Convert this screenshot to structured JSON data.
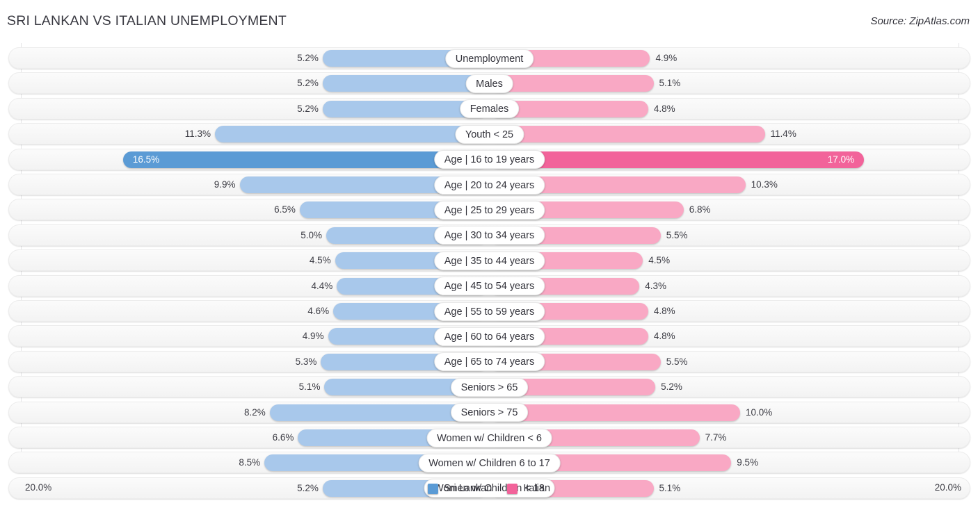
{
  "header": {
    "title": "SRI LANKAN VS ITALIAN UNEMPLOYMENT",
    "source": "Source: ZipAtlas.com"
  },
  "axis": {
    "left_label": "20.0%",
    "right_label": "20.0%",
    "max": 20.0
  },
  "legend": {
    "items": [
      {
        "label": "Sri Lankan",
        "color": "#5b9bd5"
      },
      {
        "label": "Italian",
        "color": "#f2639a"
      }
    ]
  },
  "colors": {
    "blue_light": "#a8c8eb",
    "blue_dark": "#5b9bd5",
    "pink_light": "#f9a8c4",
    "pink_dark": "#f2639a",
    "track": "#f6f6f6",
    "text": "#3d3d45"
  },
  "chart_data": {
    "type": "bar",
    "orientation": "horizontal-diverging",
    "title": "SRI LANKAN VS ITALIAN UNEMPLOYMENT",
    "xlabel": "",
    "ylabel": "",
    "xlim": [
      0,
      20.0
    ],
    "grid": true,
    "legend_position": "bottom-center",
    "categories": [
      "Unemployment",
      "Males",
      "Females",
      "Youth < 25",
      "Age | 16 to 19 years",
      "Age | 20 to 24 years",
      "Age | 25 to 29 years",
      "Age | 30 to 34 years",
      "Age | 35 to 44 years",
      "Age | 45 to 54 years",
      "Age | 55 to 59 years",
      "Age | 60 to 64 years",
      "Age | 65 to 74 years",
      "Seniors > 65",
      "Seniors > 75",
      "Women w/ Children < 6",
      "Women w/ Children 6 to 17",
      "Women w/ Children < 18"
    ],
    "series": [
      {
        "name": "Sri Lankan",
        "side": "left",
        "values": [
          5.2,
          5.2,
          5.2,
          11.3,
          16.5,
          9.9,
          6.5,
          5.0,
          4.5,
          4.4,
          4.6,
          4.9,
          5.3,
          5.1,
          8.2,
          6.6,
          8.5,
          5.2
        ],
        "labels": [
          "5.2%",
          "5.2%",
          "5.2%",
          "11.3%",
          "16.5%",
          "9.9%",
          "6.5%",
          "5.0%",
          "4.5%",
          "4.4%",
          "4.6%",
          "4.9%",
          "5.3%",
          "5.1%",
          "8.2%",
          "6.6%",
          "8.5%",
          "5.2%"
        ]
      },
      {
        "name": "Italian",
        "side": "right",
        "values": [
          4.9,
          5.1,
          4.8,
          11.4,
          17.0,
          10.3,
          6.8,
          5.5,
          4.5,
          4.3,
          4.8,
          4.8,
          5.5,
          5.2,
          10.0,
          7.7,
          9.5,
          5.1
        ],
        "labels": [
          "4.9%",
          "5.1%",
          "4.8%",
          "11.4%",
          "17.0%",
          "10.3%",
          "6.8%",
          "5.5%",
          "4.5%",
          "4.3%",
          "4.8%",
          "4.8%",
          "5.5%",
          "5.2%",
          "10.0%",
          "7.7%",
          "9.5%",
          "5.1%"
        ]
      }
    ]
  }
}
